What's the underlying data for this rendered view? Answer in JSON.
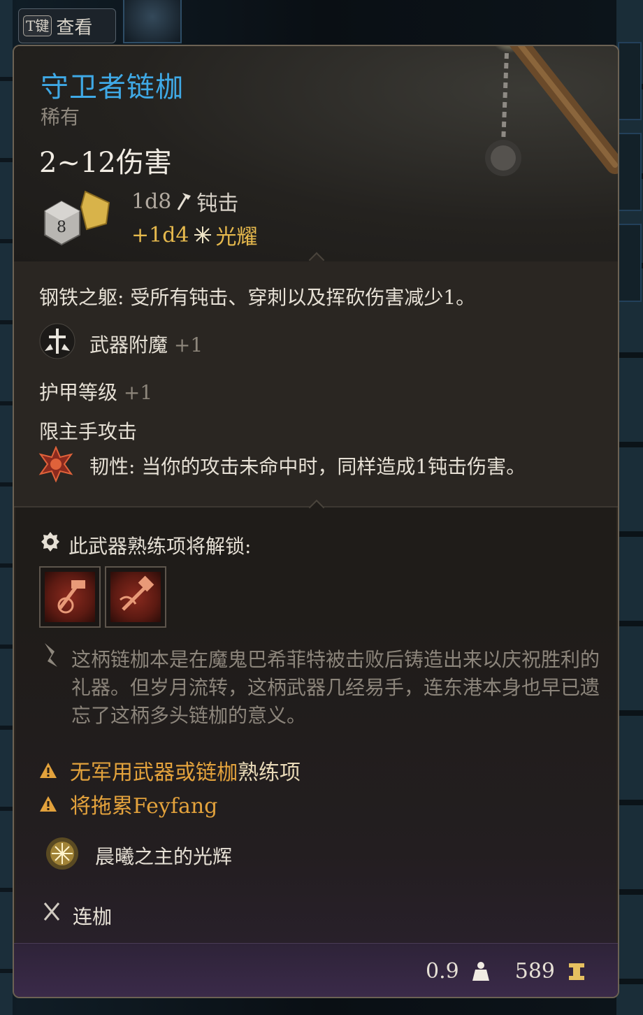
{
  "hint": {
    "key": "T键",
    "label": "查看"
  },
  "item": {
    "name": "守卫者链枷",
    "rarity": "稀有",
    "damage_range": "2~12伤害",
    "dice_face": "8",
    "base_damage": {
      "dice": "1d8",
      "type": "钝击"
    },
    "bonus_damage": {
      "dice": "+1d4",
      "type": "光耀"
    }
  },
  "properties": {
    "passive": "钢铁之躯: 受所有钝击、穿刺以及挥砍伤害减少1。",
    "enchant_label": "武器附魔",
    "enchant_value": "+1",
    "ac_label": "护甲等级",
    "ac_value": "+1",
    "restriction": "限主手攻击",
    "tenacity_name": "韧性:",
    "tenacity_desc": " 当你的攻击未命中时，同样造成1钝击伤害。"
  },
  "proficiency": {
    "title": "此武器熟练项将解锁:",
    "actions": [
      "action-1",
      "action-2"
    ]
  },
  "lore": "这柄链枷本是在魔鬼巴希菲特被击败后铸造出来以庆祝胜利的礼器。但岁月流转，这柄武器几经易手，连东港本身也早已遗忘了这柄多头链枷的意义。",
  "warnings": {
    "w1_orange": "无军用武器或链枷",
    "w1_rest": "熟练项",
    "w2": "将拖累Feyfang"
  },
  "blessing": "晨曦之主的光辉",
  "weapon_type": "连枷",
  "footer": {
    "weight": "0.9",
    "value": "589"
  },
  "colors": {
    "name": "#3fa9e6",
    "warning": "#e3a23c",
    "radiant": "#e6b94d"
  }
}
